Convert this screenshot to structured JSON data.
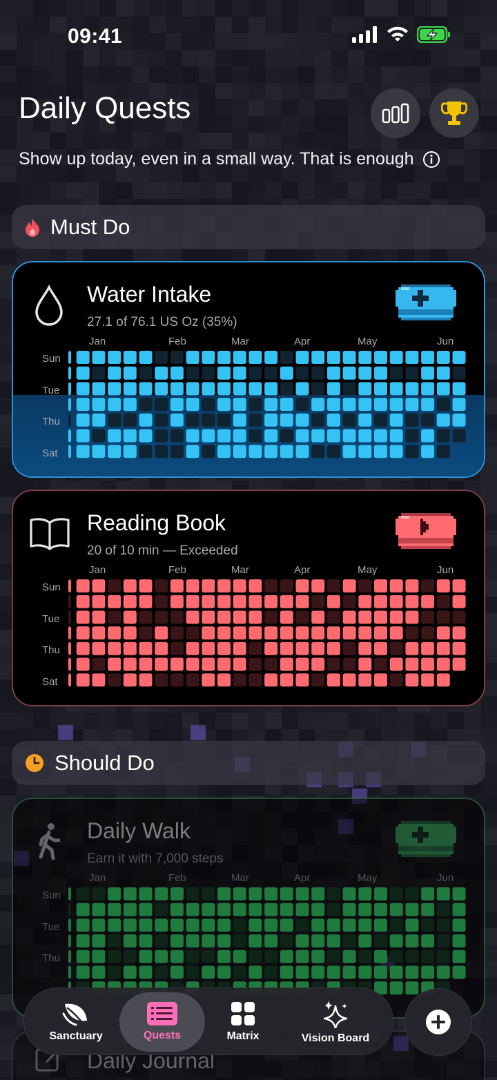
{
  "status": {
    "time": "09:41"
  },
  "header": {
    "title": "Daily Quests",
    "subtitle": "Show up today, even in a small way. That is enough",
    "stats_icon": "bar-chart-icon",
    "trophy_icon": "trophy-icon"
  },
  "sections": {
    "must_do": {
      "label": "Must Do",
      "icon": "flame-icon",
      "color": "#f0515d"
    },
    "should_do": {
      "label": "Should Do",
      "icon": "clock-icon",
      "color": "#f5a020"
    }
  },
  "months": [
    "Jan",
    "Feb",
    "Mar",
    "Apr",
    "May",
    "Jun"
  ],
  "days": [
    "Sun",
    "Tue",
    "Thu",
    "Sat"
  ],
  "quests": {
    "water": {
      "title": "Water Intake",
      "progress": "27.1 of 76.1 US Oz (35%)",
      "icon": "water-drop-icon",
      "action_icon": "pixel-plus-icon",
      "color_on": "#35c3f5",
      "color_off": "#0f2330",
      "completion": 0.35
    },
    "reading": {
      "title": "Reading Book",
      "progress": "20 of 10 min — Exceeded",
      "icon": "open-book-icon",
      "action_icon": "pixel-play-icon",
      "color_on": "#ff6b70",
      "color_off": "#3a1517"
    },
    "walk": {
      "title": "Daily Walk",
      "progress": "Earn it with 7,000 steps",
      "icon": "walking-person-icon",
      "action_icon": "pixel-plus-icon",
      "color_on": "#1f7a3e",
      "color_off": "#0d2417"
    },
    "journal": {
      "title": "Daily Journal",
      "icon": "pencil-square-icon"
    }
  },
  "tabs": [
    {
      "label": "Sanctuary",
      "icon": "leaf-icon"
    },
    {
      "label": "Quests",
      "icon": "list-icon"
    },
    {
      "label": "Matrix",
      "icon": "grid-icon"
    },
    {
      "label": "Vision Board",
      "icon": "sparkles-icon"
    }
  ],
  "fab_icon": "plus-circle-icon"
}
